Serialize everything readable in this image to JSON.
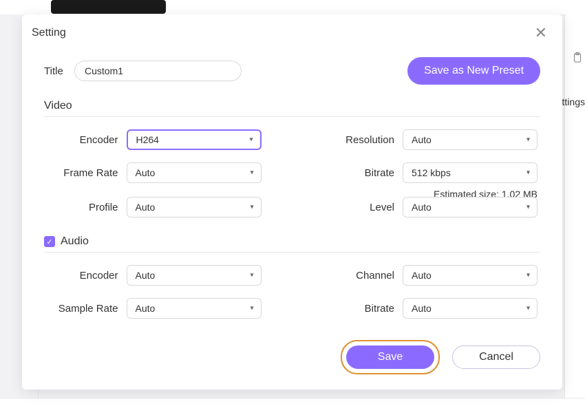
{
  "dialog": {
    "title": "Setting",
    "titleField": {
      "label": "Title",
      "value": "Custom1"
    },
    "savePresetLabel": "Save as New Preset"
  },
  "video": {
    "heading": "Video",
    "encoder": {
      "label": "Encoder",
      "value": "H264"
    },
    "resolution": {
      "label": "Resolution",
      "value": "Auto"
    },
    "frameRate": {
      "label": "Frame Rate",
      "value": "Auto"
    },
    "bitrate": {
      "label": "Bitrate",
      "value": "512 kbps"
    },
    "estimatedSize": "Estimated size: 1.02 MB",
    "profile": {
      "label": "Profile",
      "value": "Auto"
    },
    "level": {
      "label": "Level",
      "value": "Auto"
    }
  },
  "audio": {
    "heading": "Audio",
    "enabled": true,
    "encoder": {
      "label": "Encoder",
      "value": "Auto"
    },
    "channel": {
      "label": "Channel",
      "value": "Auto"
    },
    "sampleRate": {
      "label": "Sample Rate",
      "value": "Auto"
    },
    "bitrate": {
      "label": "Bitrate",
      "value": "Auto"
    }
  },
  "footer": {
    "saveLabel": "Save",
    "cancelLabel": "Cancel"
  },
  "background": {
    "rightText": "ttings"
  }
}
